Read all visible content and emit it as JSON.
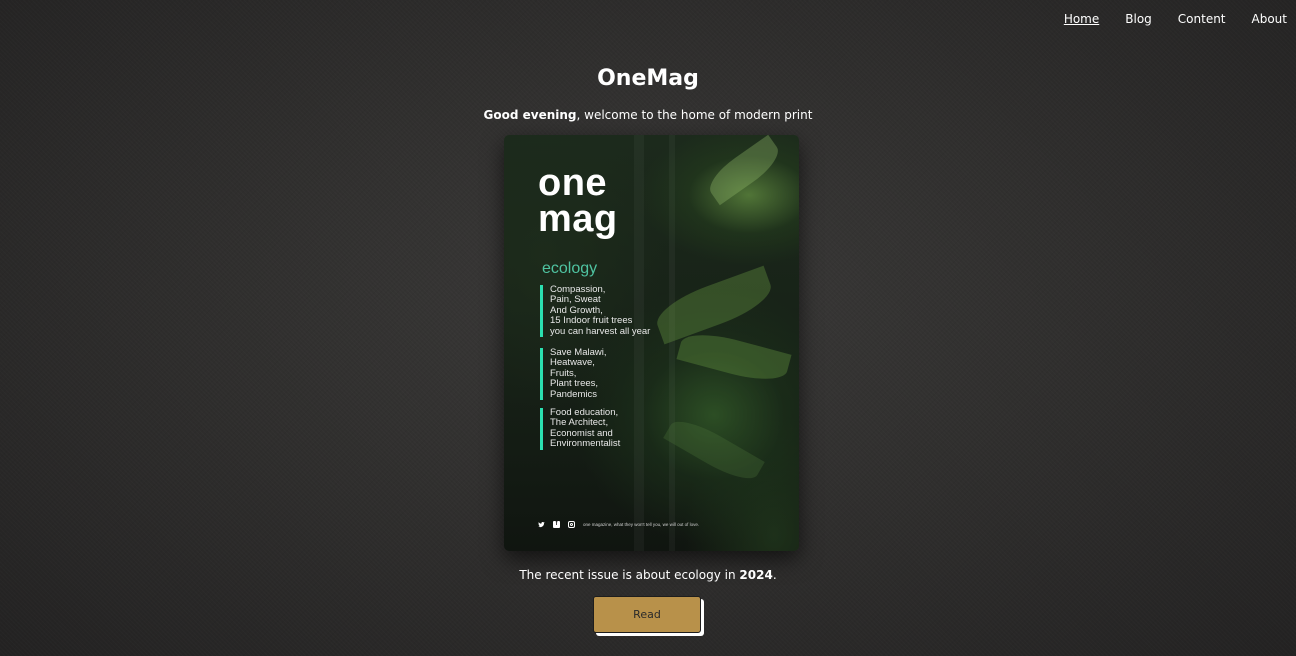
{
  "nav": {
    "items": [
      {
        "label": "Home",
        "active": true
      },
      {
        "label": "Blog",
        "active": false
      },
      {
        "label": "Content",
        "active": false
      },
      {
        "label": "About",
        "active": false
      }
    ]
  },
  "header": {
    "title": "OneMag",
    "greeting_bold": "Good evening",
    "greeting_rest": ", welcome to the home of modern print"
  },
  "cover": {
    "brand_line1": "one",
    "brand_line2": "mag",
    "theme": "ecology",
    "blocks": [
      [
        "Compassion,",
        "Pain, Sweat",
        "And Growth,",
        "15 Indoor fruit trees",
        "you can harvest all year"
      ],
      [
        "Save Malawi,",
        "Heatwave,",
        "Fruits,",
        "Plant trees,",
        "Pandemics"
      ],
      [
        "Food education,",
        "The Architect,",
        "Economist and",
        "Environmentalist"
      ]
    ],
    "footer_text": "one magazine, what they won't tell you, we will out of love.",
    "footer_icons": [
      "twitter-icon",
      "facebook-icon",
      "instagram-icon"
    ],
    "accent_color": "#2be0b0"
  },
  "issue": {
    "text_before": "The recent issue is about ecology in ",
    "year": "2024",
    "text_after": "."
  },
  "read_button": {
    "label": "Read",
    "color": "#b8914a"
  }
}
